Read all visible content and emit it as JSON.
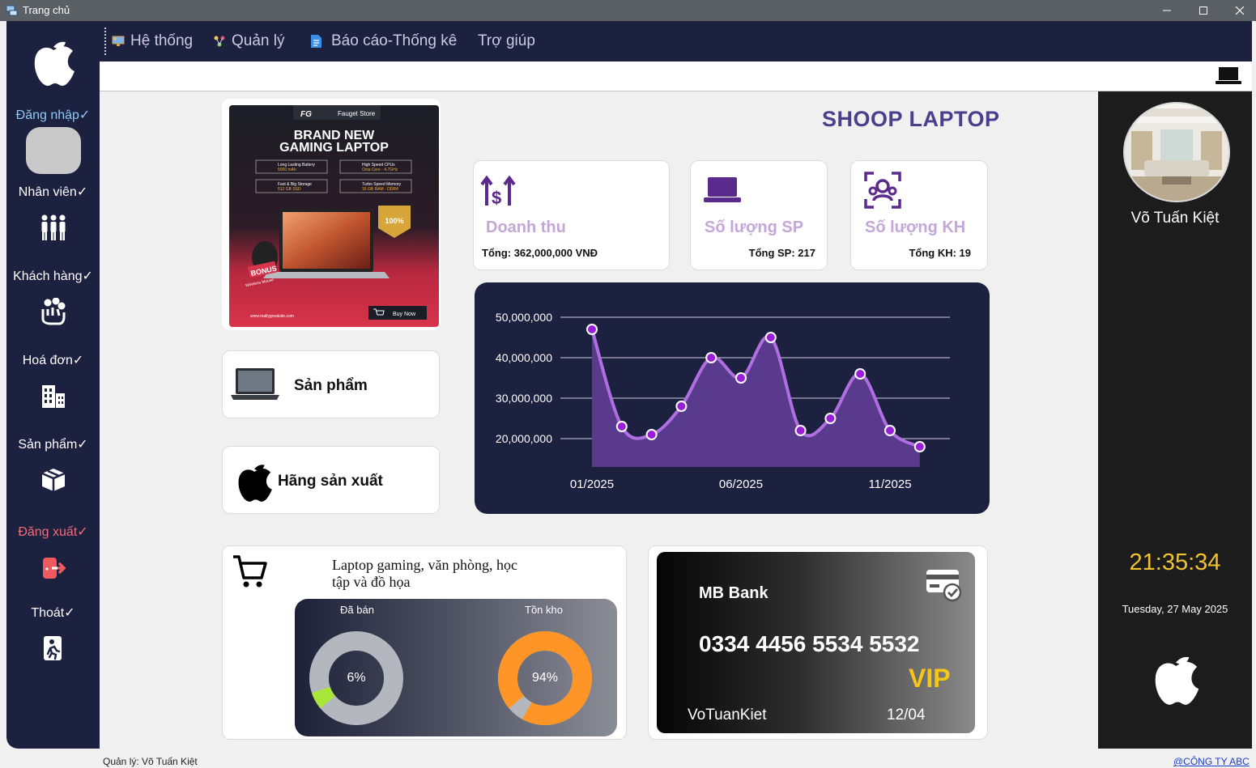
{
  "window": {
    "title": "Trang chủ"
  },
  "sidebar": {
    "items": [
      {
        "label": "Đăng nhập✓",
        "color": "#8ec9f5",
        "icon": "user-placeholder-icon"
      },
      {
        "label": "Nhân viên✓",
        "color": "#ffffff",
        "icon": "people-group-icon"
      },
      {
        "label": "Khách hàng✓",
        "color": "#ffffff",
        "icon": "hand-people-icon"
      },
      {
        "label": "Hoá đơn✓",
        "color": "#ffffff",
        "icon": "building-icon"
      },
      {
        "label": "Sản phẩm✓",
        "color": "#ffffff",
        "icon": "box-icon"
      },
      {
        "label": "Đăng xuất✓",
        "color": "#f26d7a",
        "icon": "logout-icon"
      },
      {
        "label": "Thoát✓",
        "color": "#ffffff",
        "icon": "exit-icon"
      }
    ]
  },
  "menu": {
    "items": [
      {
        "label": "Hệ thống",
        "icon": "monitor-icon"
      },
      {
        "label": "Quản lý",
        "icon": "nodes-icon"
      },
      {
        "label": "Báo cáo-Thống kê",
        "icon": "report-icon"
      },
      {
        "label": "Trợ giúp",
        "icon": ""
      }
    ]
  },
  "banner": {
    "brand": "Fauget Store",
    "title1": "BRAND NEW",
    "title2": "GAMING LAPTOP",
    "features": [
      {
        "name": "Long Lasting Battery",
        "value": "5000 mAh"
      },
      {
        "name": "High Speed CPUs",
        "value": "Octa Core - 4.7GHz"
      },
      {
        "name": "Fast & Big Storage",
        "value": "512 GB SSD"
      },
      {
        "name": "Turbo Speed Memory",
        "value": "16 GB RAM - DDR4"
      }
    ],
    "badge": "100%",
    "bonus": "BONUS",
    "bonus_sub": "Wireless Mouse",
    "website": "www.reallygreatsite.com",
    "buy": "Buy Now"
  },
  "shop_title": "SHOOP LAPTOP",
  "stats": {
    "revenue": {
      "title": "Doanh thu",
      "total": "Tổng: 362,000,000 VNĐ"
    },
    "products": {
      "title": "Số lượng SP",
      "total": "Tổng SP: 217"
    },
    "customers": {
      "title": "Số lượng KH",
      "total": "Tổng KH: 19"
    }
  },
  "buttons": {
    "products": "Sản phẩm",
    "manufacturers": "Hãng sản xuất"
  },
  "chart_data": {
    "type": "area",
    "x": [
      "01/2025",
      "02/2025",
      "03/2025",
      "04/2025",
      "05/2025",
      "06/2025",
      "07/2025",
      "08/2025",
      "09/2025",
      "10/2025",
      "11/2025",
      "12/2025"
    ],
    "values": [
      47000000,
      23000000,
      21000000,
      28000000,
      40000000,
      35000000,
      45000000,
      22000000,
      25000000,
      36000000,
      22000000,
      18000000
    ],
    "xticks": [
      "01/2025",
      "06/2025",
      "11/2025"
    ],
    "yticks": [
      "50,000,000",
      "40,000,000",
      "30,000,000",
      "20,000,000"
    ],
    "ylim": [
      13000000,
      50000000
    ],
    "line_color": "#b06fe0",
    "fill_color": "#5a3a8c",
    "marker_color": "#9a1ed8",
    "grid": true
  },
  "summary": {
    "description": "Laptop gaming, văn phòng, học tập và đồ họa",
    "sold": {
      "label": "Đã bán",
      "percent": "6%",
      "fraction": 0.06,
      "color": "#a8e63a"
    },
    "stock": {
      "label": "Tồn kho",
      "percent": "94%",
      "fraction": 0.94,
      "color": "#ff9526"
    }
  },
  "bank_card": {
    "bank": "MB Bank",
    "number": "0334 4456 5534 5532",
    "tier": "VIP",
    "holder": "VoTuanKiet",
    "expiry": "12/04"
  },
  "profile": {
    "name": "Võ Tuấn Kiệt",
    "time": "21:35:34",
    "date": "Tuesday, 27 May 2025"
  },
  "status": {
    "manager": "Quản lý: Võ Tuấn Kiệt",
    "company": "@CÔNG TY ABC"
  }
}
